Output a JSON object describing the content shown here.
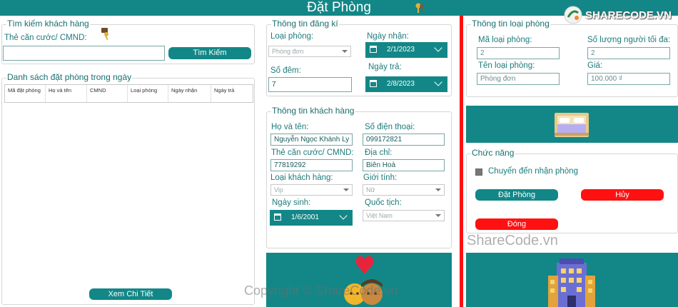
{
  "window": {
    "title": "Đặt Phòng"
  },
  "brand": {
    "logo_text": "SHARECODE.VN"
  },
  "search": {
    "legend": "Tìm kiếm khách hàng",
    "id_label": "Thẻ căn cước/ CMND:",
    "id_value": "",
    "search_button": "Tìm Kiếm"
  },
  "booking_list": {
    "legend": "Danh sách đặt phòng trong ngày",
    "columns": [
      "Mã đặt phòng",
      "Họ và tên",
      "CMND",
      "Loại phòng",
      "Ngày nhận",
      "Ngày trả"
    ],
    "rows": [],
    "detail_button": "Xem Chi Tiết"
  },
  "registration": {
    "legend": "Thông tin đăng kí",
    "room_type_label": "Loại phòng:",
    "room_type_value": "Phòng đơn",
    "checkin_label": "Ngày nhận:",
    "checkin_value": "2/1/2023",
    "nights_label": "Số đêm:",
    "nights_value": "7",
    "checkout_label": "Ngày trả:",
    "checkout_value": "2/8/2023"
  },
  "customer": {
    "legend": "Thông tin khách hàng",
    "name_label": "Họ và tên:",
    "name_value": "Nguyễn Ngọc Khánh Ly",
    "phone_label": "Số điện thoại:",
    "phone_value": "099172821",
    "id_label": "Thẻ căn cước/ CMND:",
    "id_value": "77819292",
    "address_label": "Địa chỉ:",
    "address_value": "Biên Hoà",
    "type_label": "Loại khách hàng:",
    "type_value": "Vip",
    "gender_label": "Giới tính:",
    "gender_value": "Nữ",
    "dob_label": "Ngày sinh:",
    "dob_value": "1/6/2001",
    "nationality_label": "Quốc tịch:",
    "nationality_value": "Việt Nam"
  },
  "room_type_info": {
    "legend": "Thông tin loại phòng",
    "code_label": "Mã loại phòng:",
    "code_value": "2",
    "capacity_label": "Số lượng người tối đa:",
    "capacity_value": "2",
    "name_label": "Tên loại phòng:",
    "name_value": "Phòng đơn",
    "price_label": "Giá:",
    "price_value": "100.000 ₫"
  },
  "functions": {
    "legend": "Chức năng",
    "transfer_checkbox": "Chuyển đến nhận phòng",
    "transfer_checked": false,
    "book_button": "Đặt Phòng",
    "cancel_button": "Hủy",
    "close_button": "Đóng"
  },
  "watermark": {
    "site": "ShareCode.vn",
    "copyright": "Copyright © ShareCode.vn"
  },
  "colors": {
    "accent": "#138787",
    "danger": "#ff1111",
    "label": "#1e7b7b"
  }
}
